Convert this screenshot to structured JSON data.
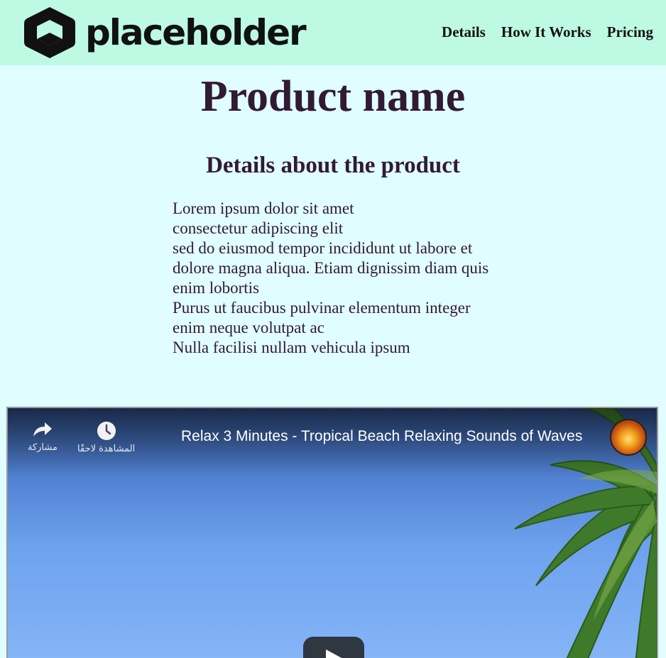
{
  "header": {
    "logo_text": "placeholder",
    "nav": [
      "Details",
      "How It Works",
      "Pricing"
    ]
  },
  "main": {
    "title": "Product name",
    "subtitle": "Details about the product",
    "description_lines": [
      "Lorem ipsum dolor sit amet",
      "consectetur adipiscing elit",
      "sed do eiusmod tempor incididunt ut labore et",
      "dolore magna aliqua. Etiam dignissim diam quis",
      "enim lobortis",
      "Purus ut faucibus pulvinar elementum integer",
      "enim neque volutpat ac",
      "Nulla facilisi nullam vehicula ipsum"
    ]
  },
  "video": {
    "title": "Relax 3 Minutes - Tropical Beach Relaxing Sounds of Waves",
    "share_label": "مشاركة",
    "watch_later_label": "المشاهدة لاحقًا",
    "share_icon": "share-icon",
    "watch_later_icon": "clock-icon",
    "play_icon": "play-icon"
  },
  "colors": {
    "header_bg": "#bdf9e3",
    "page_bg": "#e0fdff",
    "heading": "#321a34"
  }
}
